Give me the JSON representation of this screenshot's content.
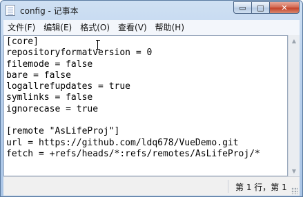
{
  "window": {
    "title": "config - 记事本"
  },
  "caption_buttons": {
    "minimize": "▭",
    "maximize": "□",
    "close": "✕"
  },
  "menu": [
    {
      "label": "文件(F)"
    },
    {
      "label": "编辑(E)"
    },
    {
      "label": "格式(O)"
    },
    {
      "label": "查看(V)"
    },
    {
      "label": "帮助(H)"
    }
  ],
  "editor": {
    "lines": [
      "[core]",
      "repositoryformatversion = 0",
      "filemode = false",
      "bare = false",
      "logallrefupdates = true",
      "symlinks = false",
      "ignorecase = true",
      "",
      "[remote \"AsLifeProj\"]",
      "url = https://github.com/ldq678/VueDemo.git",
      "fetch = +refs/heads/*:refs/remotes/AsLifeProj/*"
    ]
  },
  "status": {
    "position": "第 1 行，第 1"
  },
  "icons": {
    "app": "notepad-icon",
    "scroll_up": "scroll-up-icon",
    "scroll_down": "scroll-down-icon",
    "text_cursor": "ibeam-cursor-icon",
    "grip": "resize-grip-icon"
  }
}
